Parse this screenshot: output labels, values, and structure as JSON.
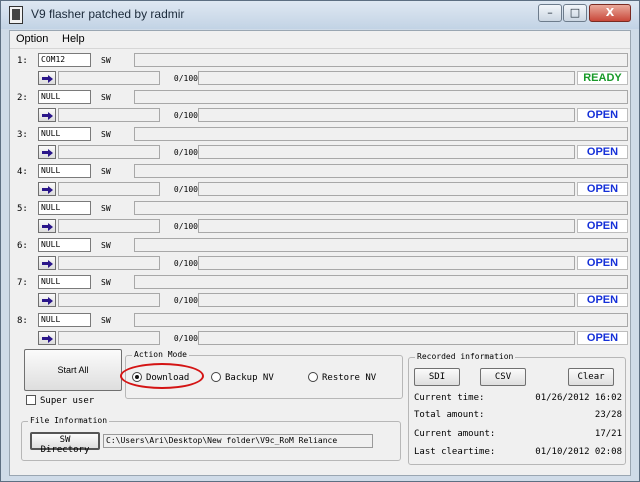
{
  "window": {
    "title": "V9 flasher patched by radmir",
    "minimize_glyph": "–",
    "maximize_glyph": "□",
    "close_glyph": "X"
  },
  "menu": {
    "option": "Option",
    "help": "Help"
  },
  "ports": [
    {
      "number": "1:",
      "port": "COM12",
      "sw_label": "SW",
      "progress": "0/100",
      "status": "READY"
    },
    {
      "number": "2:",
      "port": "NULL",
      "sw_label": "SW",
      "progress": "0/100",
      "status": "OPEN"
    },
    {
      "number": "3:",
      "port": "NULL",
      "sw_label": "SW",
      "progress": "0/100",
      "status": "OPEN"
    },
    {
      "number": "4:",
      "port": "NULL",
      "sw_label": "SW",
      "progress": "0/100",
      "status": "OPEN"
    },
    {
      "number": "5:",
      "port": "NULL",
      "sw_label": "SW",
      "progress": "0/100",
      "status": "OPEN"
    },
    {
      "number": "6:",
      "port": "NULL",
      "sw_label": "SW",
      "progress": "0/100",
      "status": "OPEN"
    },
    {
      "number": "7:",
      "port": "NULL",
      "sw_label": "SW",
      "progress": "0/100",
      "status": "OPEN"
    },
    {
      "number": "8:",
      "port": "NULL",
      "sw_label": "SW",
      "progress": "0/100",
      "status": "OPEN"
    }
  ],
  "colors": {
    "ready": "#1a9a2a",
    "open": "#1530d8",
    "annotation": "#d41414"
  },
  "controls": {
    "start_all": "Start All",
    "super_user": "Super user",
    "super_user_checked": false
  },
  "action_mode": {
    "title": "Action Mode",
    "selected": "Download",
    "options": [
      "Download",
      "Backup NV",
      "Restore NV"
    ]
  },
  "recorded": {
    "title": "Recorded information",
    "buttons": {
      "sdi": "SDI",
      "csv": "CSV",
      "clear": "Clear"
    },
    "current_time_label": "Current time:",
    "current_time_value": "01/26/2012 16:02",
    "total_amount_label": "Total amount:",
    "total_amount_value": "23/28",
    "current_amount_label": "Current amount:",
    "current_amount_value": "17/21",
    "last_cleartime_label": "Last cleartime:",
    "last_cleartime_value": "01/10/2012 02:08"
  },
  "file_info": {
    "title": "File Information",
    "sw_directory_button": "SW Directory",
    "path": "C:\\Users\\Ari\\Desktop\\New folder\\V9c_RoM Reliance"
  }
}
